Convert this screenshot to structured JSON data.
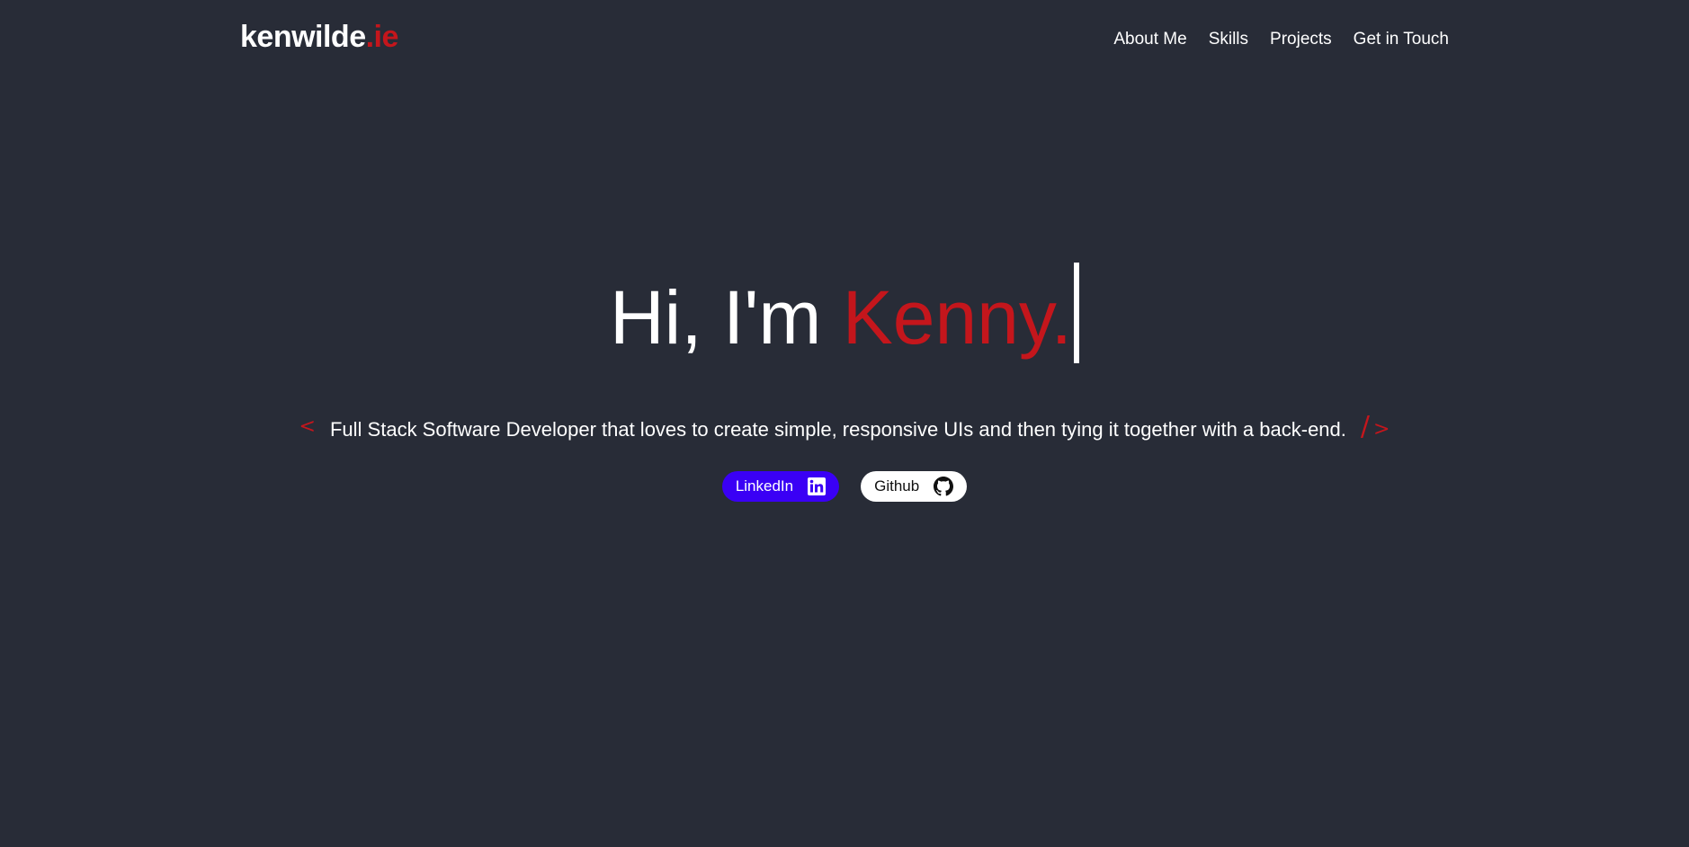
{
  "header": {
    "logo_main": "kenwilde",
    "logo_tld": ".ie",
    "nav": [
      {
        "label": "About Me"
      },
      {
        "label": "Skills"
      },
      {
        "label": "Projects"
      },
      {
        "label": "Get in Touch"
      }
    ]
  },
  "hero": {
    "greeting": "Hi, I'm ",
    "name": "Kenny.",
    "tag_open": "<",
    "tag_close_slash": "/",
    "tag_close": ">",
    "tagline": "Full Stack Software Developer that loves to create simple, responsive UIs and then tying it together with a back-end."
  },
  "buttons": {
    "linkedin_label": "LinkedIn",
    "linkedin_icon": "linkedin-icon",
    "github_label": "Github",
    "github_icon": "github-icon"
  },
  "colors": {
    "background": "#282c37",
    "accent": "#c4161c",
    "linkedin": "#3a00f5",
    "text": "#ffffff"
  }
}
